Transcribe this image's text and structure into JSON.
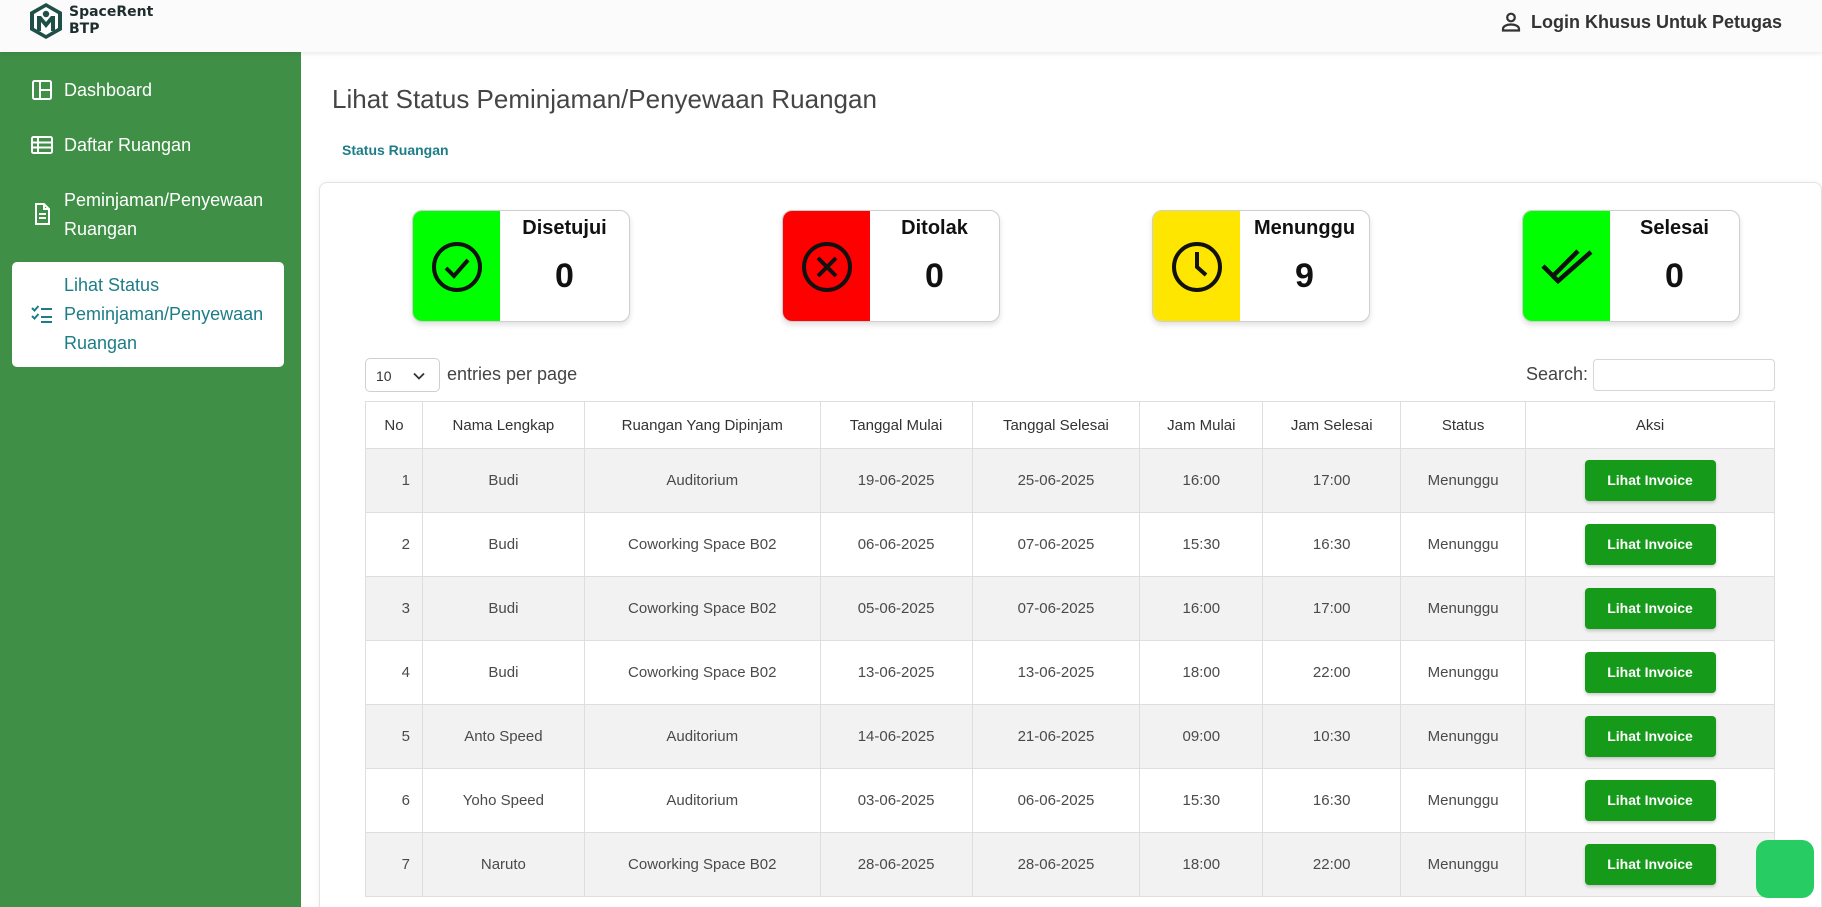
{
  "header": {
    "brand_line1": "SpaceRent",
    "brand_line2": "BTP",
    "login_label": "Login Khusus Untuk Petugas"
  },
  "sidebar": {
    "items": [
      {
        "label": "Dashboard",
        "icon": "dashboard-icon"
      },
      {
        "label": "Daftar Ruangan",
        "icon": "table-icon"
      },
      {
        "label": "Peminjaman/Penyewaan Ruangan",
        "icon": "document-icon"
      },
      {
        "label": "Lihat Status Peminjaman/Penyewaan Ruangan",
        "icon": "checklist-icon",
        "active": true
      }
    ]
  },
  "main": {
    "title": "Lihat Status Peminjaman/Penyewaan Ruangan",
    "breadcrumb": "Status Ruangan"
  },
  "cards": [
    {
      "label": "Disetujui",
      "value": "0",
      "color": "#00ff00",
      "icon": "check-circle-icon"
    },
    {
      "label": "Ditolak",
      "value": "0",
      "color": "#ff0000",
      "icon": "x-circle-icon"
    },
    {
      "label": "Menunggu",
      "value": "9",
      "color": "#ffe600",
      "icon": "clock-icon"
    },
    {
      "label": "Selesai",
      "value": "0",
      "color": "#00ff00",
      "icon": "double-check-icon"
    }
  ],
  "table_controls": {
    "entries_value": "10",
    "entries_label": "entries per page",
    "search_label": "Search:",
    "search_value": ""
  },
  "table": {
    "columns": [
      "No",
      "Nama Lengkap",
      "Ruangan Yang Dipinjam",
      "Tanggal Mulai",
      "Tanggal Selesai",
      "Jam Mulai",
      "Jam Selesai",
      "Status",
      "Aksi"
    ],
    "action_label": "Lihat Invoice",
    "rows": [
      [
        "1",
        "Budi",
        "Auditorium",
        "19-06-2025",
        "25-06-2025",
        "16:00",
        "17:00",
        "Menunggu"
      ],
      [
        "2",
        "Budi",
        "Coworking Space B02",
        "06-06-2025",
        "07-06-2025",
        "15:30",
        "16:30",
        "Menunggu"
      ],
      [
        "3",
        "Budi",
        "Coworking Space B02",
        "05-06-2025",
        "07-06-2025",
        "16:00",
        "17:00",
        "Menunggu"
      ],
      [
        "4",
        "Budi",
        "Coworking Space B02",
        "13-06-2025",
        "13-06-2025",
        "18:00",
        "22:00",
        "Menunggu"
      ],
      [
        "5",
        "Anto Speed",
        "Auditorium",
        "14-06-2025",
        "21-06-2025",
        "09:00",
        "10:30",
        "Menunggu"
      ],
      [
        "6",
        "Yoho Speed",
        "Auditorium",
        "03-06-2025",
        "06-06-2025",
        "15:30",
        "16:30",
        "Menunggu"
      ],
      [
        "7",
        "Naruto",
        "Coworking Space B02",
        "28-06-2025",
        "28-06-2025",
        "18:00",
        "22:00",
        "Menunggu"
      ]
    ]
  },
  "colors": {
    "sidebar": "#3f8f46",
    "accent": "#1d7d86",
    "button": "#169a1a",
    "chat": "#27cc63"
  }
}
